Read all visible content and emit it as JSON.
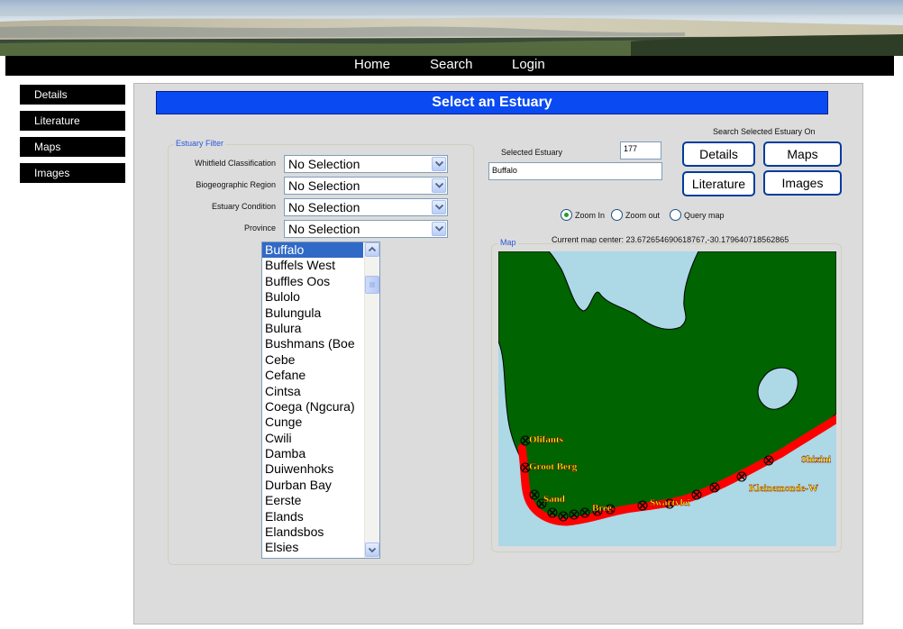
{
  "nav": {
    "home": "Home",
    "search": "Search",
    "login": "Login"
  },
  "sidebar": {
    "items": [
      {
        "label": "Details"
      },
      {
        "label": "Literature"
      },
      {
        "label": "Maps"
      },
      {
        "label": "Images"
      }
    ]
  },
  "main": {
    "title": "Select an Estuary",
    "filter": {
      "legend": "Estuary Filter",
      "fields": [
        {
          "label": "Whitfield Classification",
          "value": "No Selection"
        },
        {
          "label": "Biogeographic Region",
          "value": "No Selection"
        },
        {
          "label": "Estuary Condition",
          "value": "No Selection"
        },
        {
          "label": "Province",
          "value": "No Selection"
        }
      ],
      "list": [
        "Buffalo",
        "Buffels West",
        "Buffles Oos",
        "Bulolo",
        "Bulungula",
        "Bulura",
        "Bushmans (Boe",
        "Cebe",
        "Cefane",
        "Cintsa",
        "Coega (Ngcura)",
        "Cunge",
        "Cwili",
        "Damba",
        "Duiwenhoks",
        "Durban Bay",
        "Eerste",
        "Elands",
        "Elandsbos",
        "Elsies"
      ],
      "selected_index": 0
    },
    "selected": {
      "label": "Selected Estuary",
      "id": "177",
      "name": "Buffalo"
    },
    "search_on": {
      "label": "Search Selected Estuary On",
      "buttons": {
        "details": "Details",
        "maps": "Maps",
        "literature": "Literature",
        "images": "Images"
      }
    },
    "map_mode": {
      "options": [
        "Zoom In",
        "Zoom out",
        "Query map"
      ],
      "selected": "Zoom In"
    },
    "map_center": "Current map center: 23.672654690618767,-30.179640718562865",
    "map": {
      "legend": "Map",
      "labels": [
        "Olifants",
        "Groot Berg",
        "Sand",
        "Bree",
        "Swartvlei",
        "Shixini",
        "Kleinemonde-W"
      ],
      "colors": {
        "land": "#006400",
        "water": "#add8e6",
        "estuary": "#ff0000",
        "label_text": "#ffff00"
      }
    }
  }
}
